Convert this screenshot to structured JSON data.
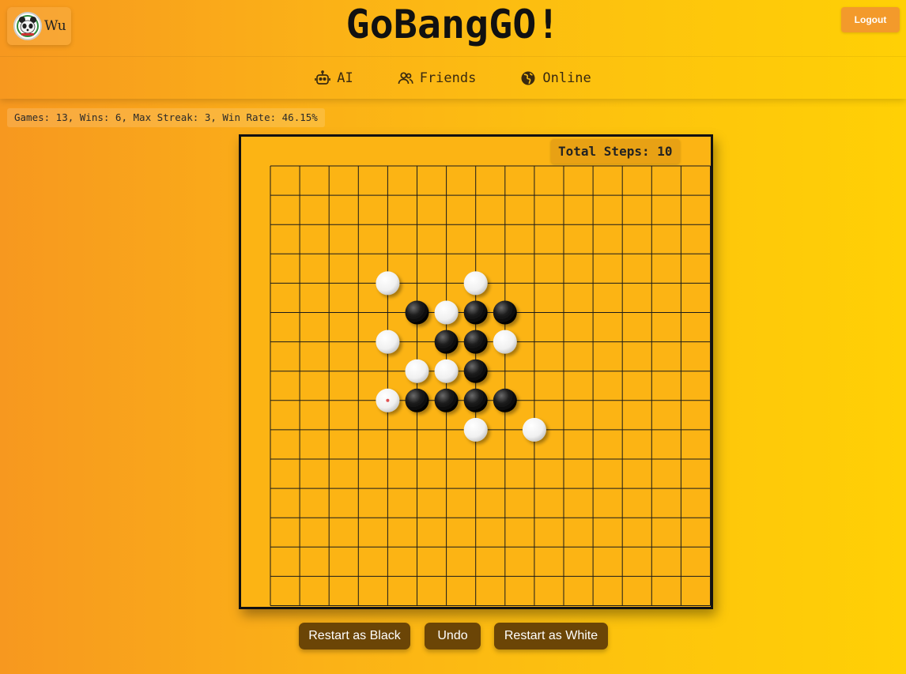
{
  "app": {
    "title": "GoBangGO!"
  },
  "user": {
    "name": "Wu",
    "avatar_icon": "panda-avatar-icon"
  },
  "header": {
    "logout_label": "Logout"
  },
  "nav": {
    "items": [
      {
        "label": "AI",
        "icon": "robot-icon"
      },
      {
        "label": "Friends",
        "icon": "users-icon"
      },
      {
        "label": "Online",
        "icon": "globe-icon"
      }
    ]
  },
  "stats": {
    "text": "Games: 13, Wins: 6, Max Streak: 3, Win Rate: 46.15%"
  },
  "board": {
    "steps_text": "Total Steps: 10",
    "size": 15,
    "stones": [
      {
        "color": "white",
        "col": 4,
        "row": 4
      },
      {
        "color": "white",
        "col": 7,
        "row": 4
      },
      {
        "color": "black",
        "col": 5,
        "row": 5
      },
      {
        "color": "white",
        "col": 6,
        "row": 5
      },
      {
        "color": "black",
        "col": 7,
        "row": 5
      },
      {
        "color": "black",
        "col": 8,
        "row": 5
      },
      {
        "color": "white",
        "col": 4,
        "row": 6
      },
      {
        "color": "black",
        "col": 6,
        "row": 6
      },
      {
        "color": "black",
        "col": 7,
        "row": 6
      },
      {
        "color": "white",
        "col": 8,
        "row": 6
      },
      {
        "color": "white",
        "col": 5,
        "row": 7
      },
      {
        "color": "white",
        "col": 6,
        "row": 7
      },
      {
        "color": "black",
        "col": 7,
        "row": 7
      },
      {
        "color": "white",
        "col": 4,
        "row": 8,
        "last": true
      },
      {
        "color": "black",
        "col": 5,
        "row": 8
      },
      {
        "color": "black",
        "col": 6,
        "row": 8
      },
      {
        "color": "black",
        "col": 7,
        "row": 8
      },
      {
        "color": "black",
        "col": 8,
        "row": 8
      },
      {
        "color": "white",
        "col": 7,
        "row": 9
      },
      {
        "color": "white",
        "col": 9,
        "row": 9
      }
    ]
  },
  "controls": {
    "restart_black": "Restart as Black",
    "undo": "Undo",
    "restart_white": "Restart as White"
  },
  "colors": {
    "board": "#fcb414",
    "button": "#6b4506",
    "logout": "#f39a2b",
    "last_move_marker": "#e05050"
  }
}
